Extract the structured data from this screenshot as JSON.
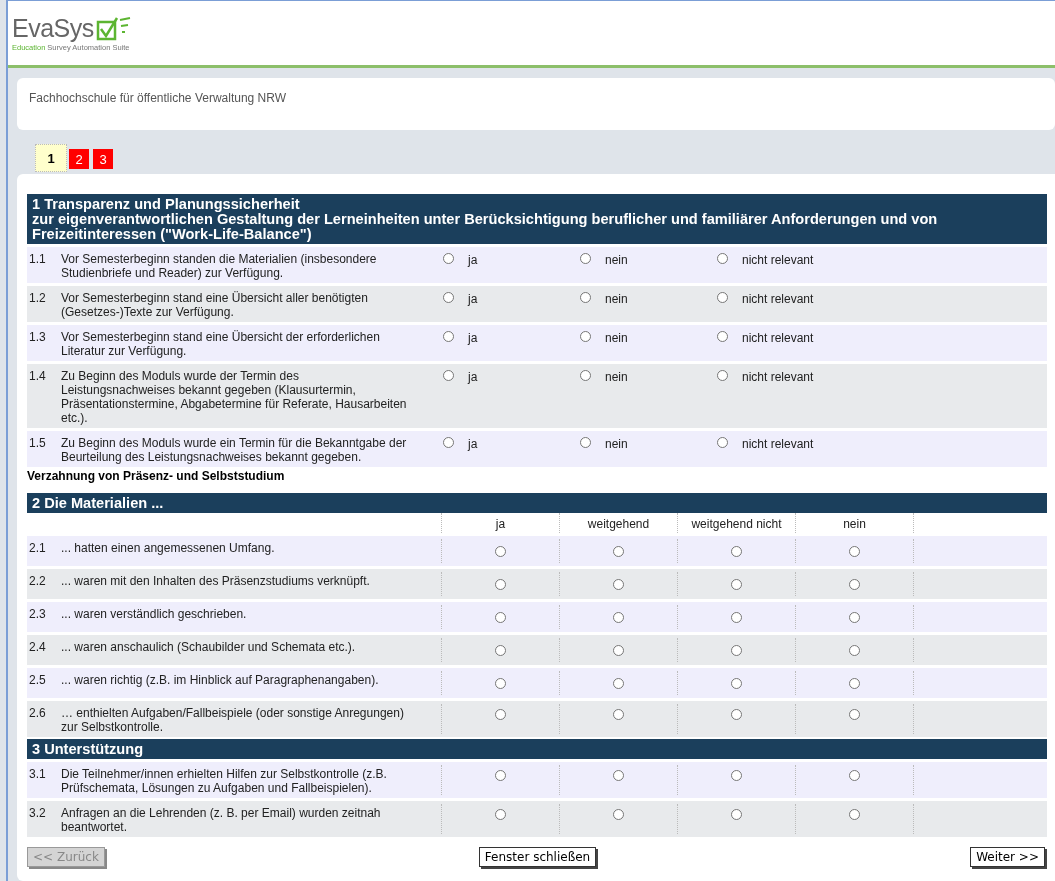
{
  "logo": {
    "name": "EvaSys",
    "tagline_highlight": "Education",
    "tagline": "Survey Automation Suite"
  },
  "institution": "Fachhochschule für öffentliche Verwaltung NRW",
  "pages": [
    {
      "label": "1",
      "selected": true
    },
    {
      "label": "2",
      "selected": false
    },
    {
      "label": "3",
      "selected": false
    }
  ],
  "sections": [
    {
      "kind": "inline",
      "title": "1  Transparenz und Planungssicherheit",
      "subtitle": "zur eigenverantwortlichen Gestaltung der Lerneinheiten unter Berücksichtigung beruflicher und familiärer Anforderungen und von Freizeitinteressen (\"Work-Life-Balance\")",
      "items": [
        {
          "number": "1.1",
          "text": "Vor Semesterbeginn standen die Materialien (insbesondere Studienbriefe und Reader) zur Verfügung.",
          "options": [
            {
              "label": "ja",
              "checked": false
            },
            {
              "label": "nein",
              "checked": false
            },
            {
              "label": "nicht relevant",
              "checked": false
            }
          ]
        },
        {
          "number": "1.2",
          "text": "Vor Semesterbeginn stand eine Übersicht aller benötigten (Gesetzes-)Texte zur Verfügung.",
          "options": [
            {
              "label": "ja",
              "checked": false
            },
            {
              "label": "nein",
              "checked": false
            },
            {
              "label": "nicht relevant",
              "checked": false
            }
          ]
        },
        {
          "number": "1.3",
          "text": "Vor Semesterbeginn stand eine Übersicht der erforderlichen Literatur zur Verfügung.",
          "options": [
            {
              "label": "ja",
              "checked": false
            },
            {
              "label": "nein",
              "checked": false
            },
            {
              "label": "nicht relevant",
              "checked": false
            }
          ]
        },
        {
          "number": "1.4",
          "text": "Zu Beginn des Moduls wurde der Termin des Leistungsnachweises bekannt gegeben (Klausurtermin, Präsentationstermine, Abgabetermine für Referate, Hausarbeiten etc.).",
          "options": [
            {
              "label": "ja",
              "checked": false
            },
            {
              "label": "nein",
              "checked": false
            },
            {
              "label": "nicht relevant",
              "checked": false
            }
          ]
        },
        {
          "number": "1.5",
          "text": "Zu Beginn des Moduls wurde ein Termin für die Bekanntgabe der Beurteilung des Leistungsnachweises bekannt gegeben.",
          "options": [
            {
              "label": "ja",
              "checked": false
            },
            {
              "label": "nein",
              "checked": false
            },
            {
              "label": "nicht relevant",
              "checked": false
            }
          ]
        }
      ]
    },
    {
      "kind": "caption",
      "text": "Verzahnung von Präsenz- und Selbststudium"
    },
    {
      "kind": "matrix",
      "title": "2  Die Materialien ...",
      "columns": [
        "ja",
        "weitgehend",
        "weitgehend nicht",
        "nein"
      ],
      "items": [
        {
          "number": "2.1",
          "text": "... hatten einen angemessenen Umfang.",
          "checked": [
            false,
            false,
            false,
            false
          ]
        },
        {
          "number": "2.2",
          "text": "... waren mit den Inhalten des Präsenzstudiums verknüpft.",
          "checked": [
            false,
            false,
            false,
            false
          ]
        },
        {
          "number": "2.3",
          "text": "... waren verständlich geschrieben.",
          "checked": [
            false,
            false,
            false,
            false
          ]
        },
        {
          "number": "2.4",
          "text": "... waren anschaulich (Schaubilder und Schemata etc.).",
          "checked": [
            false,
            false,
            false,
            false
          ]
        },
        {
          "number": "2.5",
          "text": "... waren richtig (z.B. im Hinblick auf Paragraphenangaben).",
          "checked": [
            false,
            false,
            false,
            false
          ]
        },
        {
          "number": "2.6",
          "text": "… enthielten Aufgaben/Fallbeispiele (oder sonstige Anregungen) zur Selbstkontrolle.",
          "checked": [
            false,
            false,
            false,
            false
          ]
        }
      ]
    },
    {
      "kind": "matrix",
      "title": "3  Unterstützung",
      "items": [
        {
          "number": "3.1",
          "text": "Die Teilnehmer/innen erhielten Hilfen zur Selbstkontrolle (z.B. Prüfschemata, Lösungen zu Aufgaben und Fallbeispielen).",
          "checked": [
            false,
            false,
            false,
            false
          ]
        },
        {
          "number": "3.2",
          "text": "Anfragen an die Lehrenden (z. B. per Email) wurden zeitnah beantwortet.",
          "checked": [
            false,
            false,
            false,
            false
          ]
        }
      ]
    }
  ],
  "buttons": {
    "back": {
      "label": "<< Zurück",
      "disabled": true
    },
    "close": {
      "label": "Fenster schließen",
      "disabled": false
    },
    "next": {
      "label": "Weiter >>",
      "disabled": false
    }
  }
}
